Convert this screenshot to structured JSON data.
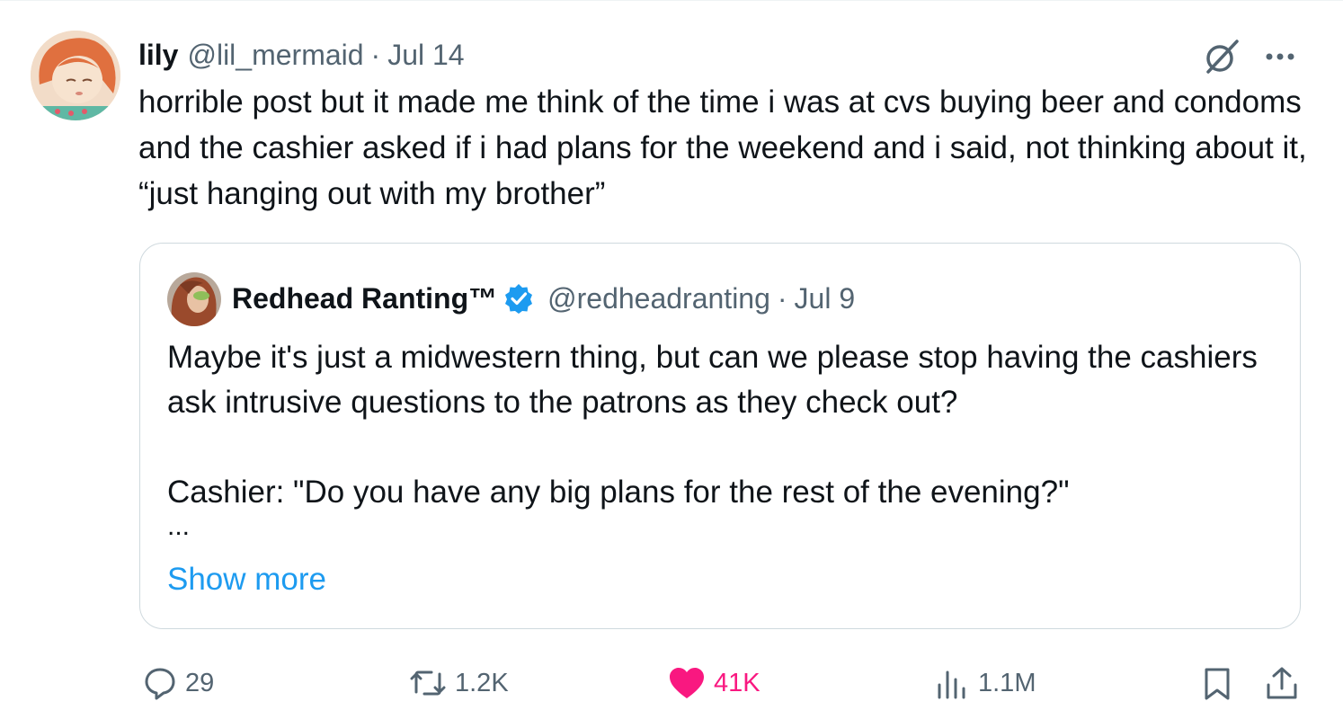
{
  "tweet": {
    "author_name": "lily",
    "author_handle": "@lil_mermaid",
    "separator": "·",
    "date": "Jul 14",
    "text": "horrible post but it made me think of the time i was at cvs buying beer and condoms and the cashier asked if i had plans for the weekend and i said, not thinking about it, “just hanging out with my brother”"
  },
  "quote": {
    "author_name": "Redhead Ranting™",
    "verified": true,
    "author_handle": "@redheadranting",
    "separator": "·",
    "date": "Jul 9",
    "paragraph_1": "Maybe it's just a midwestern thing, but can we please stop having the cashiers ask intrusive questions to the patrons as they check out?",
    "paragraph_2": "Cashier: \"Do you have any big plans for the rest of the evening?\"",
    "ellipsis": "...",
    "show_more": "Show more"
  },
  "actions": {
    "replies": "29",
    "reposts": "1.2K",
    "likes": "41K",
    "views": "1.1M"
  },
  "colors": {
    "text": "#0f1419",
    "secondary": "#536471",
    "link": "#1d9bf0",
    "like": "#f91880",
    "border": "#cfd9de"
  },
  "icons": {
    "reply": "reply-icon",
    "repost": "repost-icon",
    "like": "heart-icon",
    "views": "views-icon",
    "bookmark": "bookmark-icon",
    "share": "share-icon",
    "grok": "grok-icon",
    "more": "more-icon"
  }
}
